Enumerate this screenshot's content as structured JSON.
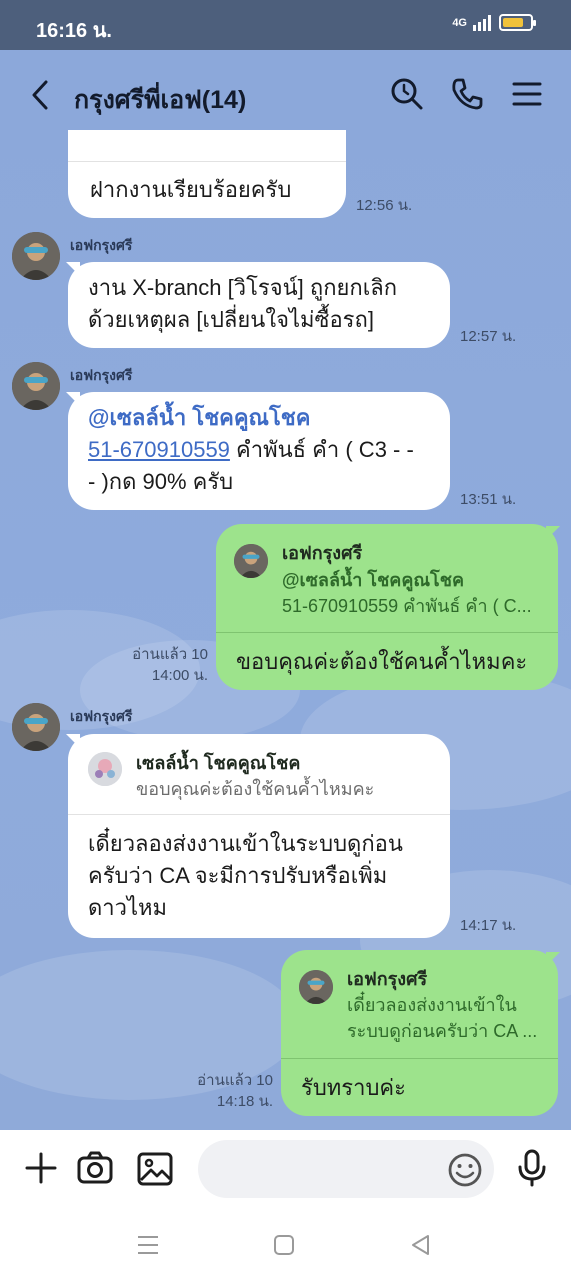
{
  "status_bar": {
    "time": "16:16 น.",
    "network": "4G"
  },
  "header": {
    "title": "กรุงศรีพี่เอฟ(14)"
  },
  "messages": [
    {
      "text": "ฝากงานเรียบร้อยครับ",
      "time": "12:56 น."
    },
    {
      "sender": "เอฟกรุงศรี",
      "text": "งาน X-branch [วิโรจน์] ถูกยกเลิก ด้วยเหตุผล [เปลี่ยนใจไม่ซื้อรถ]",
      "line1": "งาน X-branch [วิโรจน์] ถูกยกเลิก",
      "line2": "ด้วยเหตุผล [เปลี่ยนใจไม่ซื้อรถ]",
      "time": "12:57 น."
    },
    {
      "sender": "เอฟกรุงศรี",
      "mention": "@เซลล์น้ำ โชคคูณโชค",
      "link": "51-670910559",
      "rest1": " คำพันธ์ คำ ( C3 - -",
      "rest2": "- )กด 90% ครับ",
      "time": "13:51 น."
    },
    {
      "quote_name": "เอฟกรุงศรี",
      "quote_line1": "@เซลล์น้ำ โชคคูณโชค",
      "quote_line2": "51-670910559 คำพันธ์ คำ ( C...",
      "text": "ขอบคุณค่ะต้องใช้คนค้ำไหมคะ",
      "read": "อ่านแล้ว 10",
      "time": "14:00 น."
    },
    {
      "sender": "เอฟกรุงศรี",
      "quote_name": "เซลล์น้ำ โชคคูณโชค",
      "quote_line1": "ขอบคุณค่ะต้องใช้คนค้ำไหมคะ",
      "line1": "เดี๋ยวลองส่งงานเข้าในระบบดูก่อน",
      "line2": "ครับว่า CA จะมีการปรับหรือเพิ่ม",
      "line3": "ดาวไหม",
      "time": "14:17 น."
    },
    {
      "quote_name": "เอฟกรุงศรี",
      "quote_line1": "เดี๋ยวลองส่งงานเข้าใน",
      "quote_line2": "ระบบดูก่อนครับว่า CA ...",
      "text": "รับทราบค่ะ",
      "read": "อ่านแล้ว 10",
      "time": "14:18 น."
    }
  ],
  "input": {
    "placeholder": ""
  },
  "icons": {
    "back": "back-arrow-icon",
    "search": "search-icon",
    "call": "phone-icon",
    "menu": "menu-icon",
    "add": "plus-icon",
    "camera": "camera-icon",
    "gallery": "image-icon",
    "emoji": "emoji-icon",
    "mic": "microphone-icon",
    "nav_recent": "recent-apps-icon",
    "nav_home": "home-icon",
    "nav_back": "nav-back-icon"
  },
  "colors": {
    "chat_bg": "#8ca8da",
    "green_bubble": "#9de38c",
    "status_bar": "#4d5f7c",
    "battery": "#f0c23b",
    "mention": "#3e6bc5"
  }
}
